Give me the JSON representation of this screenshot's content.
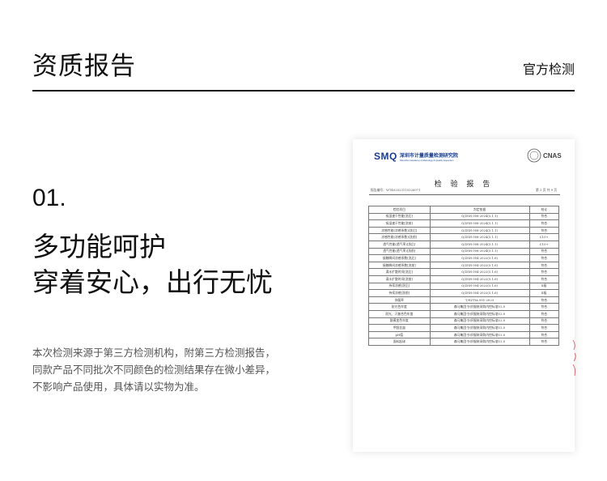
{
  "header": {
    "title": "资质报告",
    "subtitle": "官方检测"
  },
  "section": {
    "number": "01.",
    "heading_line1": "多功能呵护",
    "heading_line2": "穿着安心，出行无忧",
    "description_lines": [
      "本次检测来源于第三方检测机构，附第三方检测报告，",
      "同款产品不同批次不同颜色的检测结果存在微小差异，",
      "不影响产品使用，具体请以实物为准。"
    ]
  },
  "report": {
    "logo_mark": "SMQ",
    "logo_cn": "深圳市计量质量检测研究院",
    "logo_en": "Shenzhen Academy of Metrology & Quality Inspection",
    "cert_text": "CNAS",
    "title": "检 验 报 告",
    "report_no": "报告编号：WT402023110326971",
    "page": "第 3 页 共 9 页",
    "columns": [
      "检验项目",
      "判定依据",
      "结论"
    ],
    "rows": [
      [
        "吸湿速干性能[洗后]",
        "Q/ZSH 008-2024(5.1.1)",
        "符合"
      ],
      [
        "吸湿速干性能[洗前]",
        "Q/ZSH 008-2024(5.1.1)",
        "符合"
      ],
      [
        "凉感性能(凉感系数)[洗后]",
        "Q/ZSH 008-2024(5.1.1)",
        "符合"
      ],
      [
        "凉感性能(凉感系数)[洗前]",
        "Q/ZSH 008-2024(5.1.1)",
        "C10+"
      ],
      [
        "透气性能(透气率)[洗后]",
        "Q/ZSH 008-2024(5.1.1)",
        "C10+"
      ],
      [
        "透气性能(透气率)[洗前]",
        "Q/ZSH 008-2024(5.1.1)",
        "符合"
      ],
      [
        "接触瞬间凉感系数[洗后]",
        "Q/ZSH 004-2022(5.1.6)",
        "符合"
      ],
      [
        "接触瞬间凉感系数[洗前]",
        "Q/ZSH 004-2022(5.1.6)",
        "符合"
      ],
      [
        "滴水扩散时间[洗后]",
        "Q/ZSH 004-2022(5.1.6)",
        "符合"
      ],
      [
        "滴水扩散时间[洗前]",
        "Q/ZSH 004-2022(5.1.6)",
        "符合"
      ],
      [
        "持续凉感[洗后]",
        "Q/ZSH 004-2022(5.1.6)",
        "Ⅱ级"
      ],
      [
        "持续凉感[洗前]",
        "Q/ZSH 004-2022(5.1.6)",
        "Ⅱ级"
      ],
      [
        "抑菌率",
        "T/SZTIA 001-2023",
        "符合"
      ],
      [
        "耐光色牢度",
        "森马集团-针织服装采购内控标准V2.0",
        "符合"
      ],
      [
        "耐光、汗复合色牢度",
        "森马集团-针织服装采购内控标准V2.0",
        "符合"
      ],
      [
        "酚黄变色牢度",
        "森马集团-针织服装采购内控标准V2.0",
        "符合"
      ],
      [
        "甲醛含量",
        "森马集团-针织服装采购内控标准V2.0",
        "符合"
      ],
      [
        "pH值",
        "森马集团-针织服装采购内控标准V2.0",
        "符合"
      ],
      [
        "面料起球",
        "森马集团-针织服装采购内控标准V2.0",
        "符合"
      ]
    ]
  }
}
